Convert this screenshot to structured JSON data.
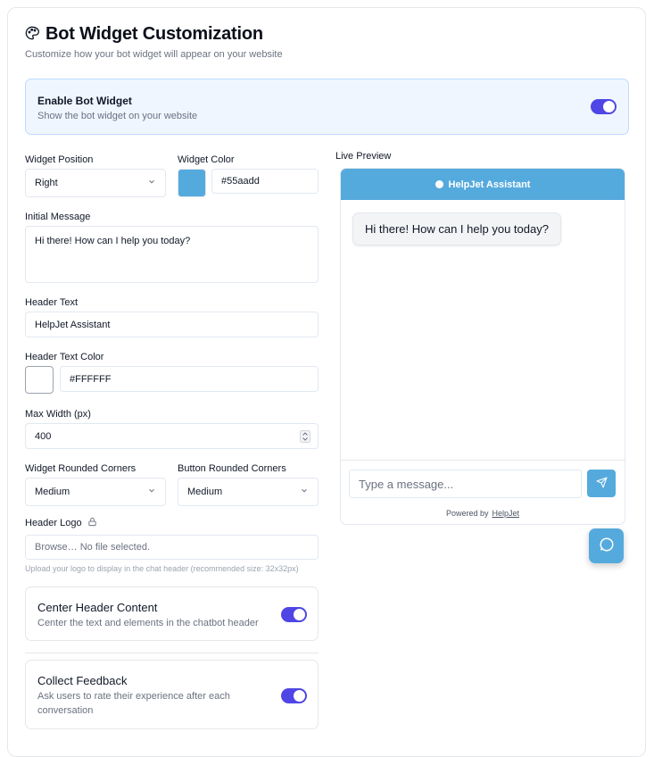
{
  "header": {
    "title": "Bot Widget Customization",
    "subtitle": "Customize how your bot widget will appear on your website"
  },
  "enable_widget": {
    "title": "Enable Bot Widget",
    "description": "Show the bot widget on your website",
    "enabled": true
  },
  "form": {
    "position": {
      "label": "Widget Position",
      "value": "Right"
    },
    "color": {
      "label": "Widget Color",
      "value": "#55aadd"
    },
    "initial_message": {
      "label": "Initial Message",
      "value": "Hi there! How can I help you today?"
    },
    "header_text": {
      "label": "Header Text",
      "value": "HelpJet Assistant"
    },
    "header_text_color": {
      "label": "Header Text Color",
      "value": "#FFFFFF"
    },
    "max_width": {
      "label": "Max Width (px)",
      "value": "400"
    },
    "widget_corners": {
      "label": "Widget Rounded Corners",
      "value": "Medium"
    },
    "button_corners": {
      "label": "Button Rounded Corners",
      "value": "Medium"
    },
    "header_logo": {
      "label": "Header Logo",
      "file_text": "Browse… No file selected.",
      "hint": "Upload your logo to display in the chat header (recommended size: 32x32px)"
    },
    "center_header": {
      "title": "Center Header Content",
      "description": "Center the text and elements in the chatbot header",
      "enabled": true
    },
    "collect_feedback": {
      "title": "Collect Feedback",
      "description": "Ask users to rate their experience after each conversation",
      "enabled": true
    }
  },
  "preview": {
    "label": "Live Preview",
    "header_text": "HelpJet Assistant",
    "bubble_text": "Hi there! How can I help you today?",
    "input_placeholder": "Type a message...",
    "powered_by": "Powered by",
    "powered_link": "HelpJet"
  },
  "colors": {
    "accent": "#4f46e5",
    "widget": "#55aadd",
    "header_text": "#FFFFFF"
  },
  "icons": {
    "title": "palette-icon",
    "lock": "lock-icon",
    "send": "send-icon",
    "chat": "chat-bubble-icon",
    "select": "chevron-down-icon",
    "stepper": "stepper-icon"
  }
}
